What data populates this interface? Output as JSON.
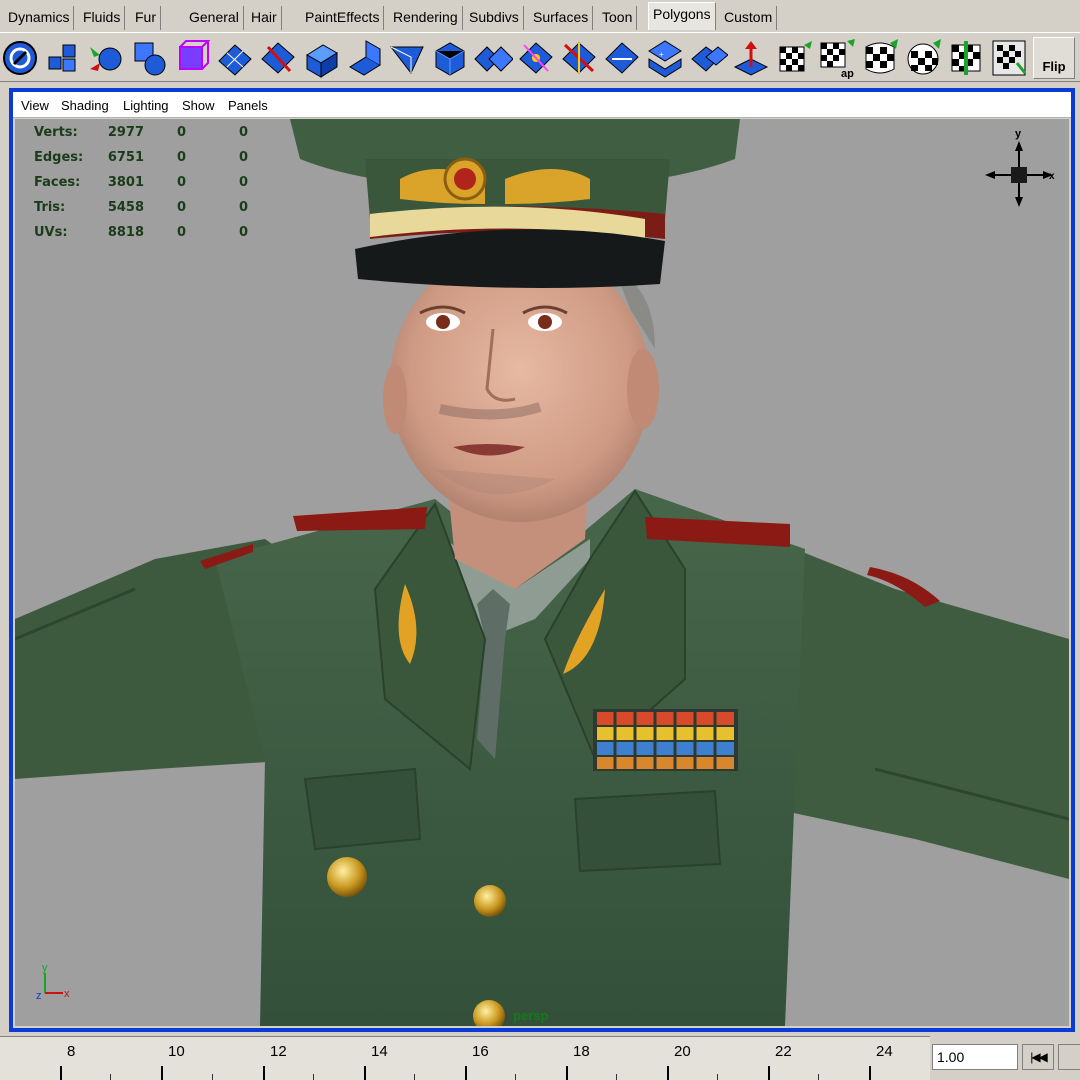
{
  "shelf": {
    "tabs": [
      "Dynamics",
      "Fluids",
      "Fur",
      "General",
      "Hair",
      "PaintEffects",
      "Rendering",
      "Subdivs",
      "Surfaces",
      "Toon",
      "Polygons",
      "Custom"
    ],
    "active_tab": "Polygons",
    "flip_label": "Flip",
    "ap_fragment": "ap"
  },
  "panel_menu": [
    "View",
    "Shading",
    "Lighting",
    "Show",
    "Panels"
  ],
  "hud": {
    "rows": [
      {
        "label": "Verts:",
        "values": [
          "2977",
          "0",
          "0"
        ]
      },
      {
        "label": "Edges:",
        "values": [
          "6751",
          "0",
          "0"
        ]
      },
      {
        "label": "Faces:",
        "values": [
          "3801",
          "0",
          "0"
        ]
      },
      {
        "label": "Tris:",
        "values": [
          "5458",
          "0",
          "0"
        ]
      },
      {
        "label": "UVs:",
        "values": [
          "8818",
          "0",
          "0"
        ]
      }
    ]
  },
  "view_cube": {
    "y": "y",
    "x": "x"
  },
  "axis_gizmo": {
    "y": "y",
    "z": "z",
    "x": "x"
  },
  "camera_name": "persp",
  "time_slider": {
    "labels": [
      "8",
      "10",
      "12",
      "14",
      "16",
      "18",
      "20",
      "22",
      "24"
    ],
    "current_time": "1.00",
    "step_back_glyph": "|◀◀"
  },
  "colors": {
    "viewport_bg": "#9f9f9f",
    "panel_border": "#0b3bd7",
    "uniform": "#3d5a3e",
    "hud_text": "#1a3c1a"
  }
}
